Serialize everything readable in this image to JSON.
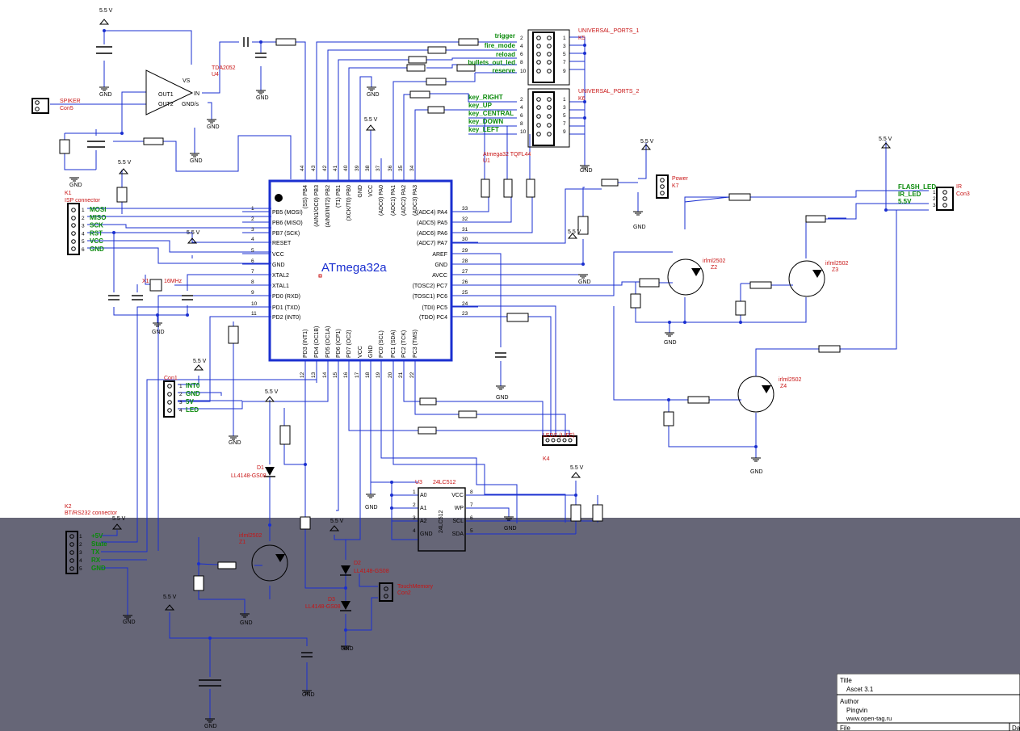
{
  "mcu": {
    "name": "ATmega32a",
    "ref": "U1",
    "package": "Atmega32 TQFL44"
  },
  "power_label": "5.5 V",
  "gnd_label": "GND",
  "mcu_left_pins": [
    {
      "num": "1",
      "name": "PB5 (MOSI)"
    },
    {
      "num": "2",
      "name": "PB6 (MISO)"
    },
    {
      "num": "3",
      "name": "PB7 (SCK)"
    },
    {
      "num": "4",
      "name": "RESET"
    },
    {
      "num": "5",
      "name": "VCC"
    },
    {
      "num": "6",
      "name": "GND"
    },
    {
      "num": "7",
      "name": "XTAL2"
    },
    {
      "num": "8",
      "name": "XTAL1"
    },
    {
      "num": "9",
      "name": "PD0 (RXD)"
    },
    {
      "num": "10",
      "name": "PD1 (TXD)"
    },
    {
      "num": "11",
      "name": "PD2 (INT0)"
    }
  ],
  "mcu_right_pins": [
    {
      "num": "33",
      "name": "(ADC4) PA4"
    },
    {
      "num": "32",
      "name": "(ADC5) PA5"
    },
    {
      "num": "31",
      "name": "(ADC6) PA6"
    },
    {
      "num": "30",
      "name": "(ADC7) PA7"
    },
    {
      "num": "29",
      "name": "AREF"
    },
    {
      "num": "28",
      "name": "GND"
    },
    {
      "num": "27",
      "name": "AVCC"
    },
    {
      "num": "26",
      "name": "(TOSC2) PC7"
    },
    {
      "num": "25",
      "name": "(TOSC1) PC6"
    },
    {
      "num": "24",
      "name": "(TDI) PC5"
    },
    {
      "num": "23",
      "name": "(TDO) PC4"
    }
  ],
  "mcu_top_pins": [
    {
      "num": "44",
      "name": "(SS) PB4"
    },
    {
      "num": "43",
      "name": "(AIN1/OC0) PB3"
    },
    {
      "num": "42",
      "name": "(AIN0/INT2) PB2"
    },
    {
      "num": "41",
      "name": "(T1) PB1"
    },
    {
      "num": "40",
      "name": "(XCK/T0) PB0"
    },
    {
      "num": "39",
      "name": "GND"
    },
    {
      "num": "38",
      "name": "VCC"
    },
    {
      "num": "37",
      "name": "(ADC0) PA0"
    },
    {
      "num": "36",
      "name": "(ADC1) PA1"
    },
    {
      "num": "35",
      "name": "(ADC2) PA2"
    },
    {
      "num": "34",
      "name": "(ADC3) PA3"
    }
  ],
  "mcu_bottom_pins": [
    {
      "num": "12",
      "name": "PD3 (INT1)"
    },
    {
      "num": "13",
      "name": "PD4 (OC1B)"
    },
    {
      "num": "14",
      "name": "PD5 (OC1A)"
    },
    {
      "num": "15",
      "name": "PD6 (ICP1)"
    },
    {
      "num": "16",
      "name": "PD7 (OC2)"
    },
    {
      "num": "17",
      "name": "VCC"
    },
    {
      "num": "18",
      "name": "GND"
    },
    {
      "num": "19",
      "name": "PC0 (SCL)"
    },
    {
      "num": "20",
      "name": "PC1 (SDA)"
    },
    {
      "num": "21",
      "name": "PC2 (TCK)"
    },
    {
      "num": "22",
      "name": "PC3 (TMS)"
    }
  ],
  "universal_ports_1": {
    "ref": "K5",
    "title": "UNIVERSAL_PORTS_1",
    "nets": [
      "trigger",
      "fire_mode",
      "reload",
      "bullets_out_led",
      "reserve"
    ]
  },
  "universal_ports_2": {
    "ref": "K6",
    "title": "UNIVERSAL_PORTS_2",
    "nets": [
      "key_RIGHT",
      "key_UP",
      "key_CENTRAL",
      "key_DOWN",
      "key_LEFT"
    ]
  },
  "isp": {
    "ref": "K1",
    "title": "ISP connector",
    "nets": [
      "MOSI",
      "MISO",
      "SCK",
      "RST",
      "VCC",
      "GND"
    ]
  },
  "con1": {
    "ref": "Con1",
    "nets": [
      "INT0",
      "GND",
      "5V",
      "LED"
    ]
  },
  "bt": {
    "ref": "K2",
    "title": "BT/RS232 connector",
    "nets": [
      "+5V",
      "State",
      "TX",
      "RX",
      "GND"
    ]
  },
  "ir": {
    "ref": "Con3",
    "title": "IR",
    "nets": [
      "FLASH_LED",
      "IR_LED",
      "5.5V"
    ]
  },
  "power_conn": {
    "ref": "K7",
    "title": "Power"
  },
  "spiker": {
    "ref": "Con5",
    "title": "SPIKER"
  },
  "touch": {
    "ref": "Con2",
    "title": "TouchMemory"
  },
  "leds": {
    "ref": "K4",
    "title": "LEDS (LIFE)"
  },
  "amp": {
    "ref": "U4",
    "name": "TDA2052",
    "pins": [
      "IN",
      "OUT1",
      "OUT2",
      "GND/s",
      "VS"
    ]
  },
  "eeprom": {
    "ref": "U3",
    "name": "24LC512",
    "pins": [
      "A0",
      "A1",
      "A2",
      "GND",
      "VCC",
      "WP",
      "SCL",
      "SDA"
    ]
  },
  "mosfets": [
    {
      "ref": "Z1",
      "name": "irlml2502"
    },
    {
      "ref": "Z2",
      "name": "irlml2502"
    },
    {
      "ref": "Z3",
      "name": "irlml2502"
    },
    {
      "ref": "Z4",
      "name": "irlml2502"
    }
  ],
  "diodes": [
    {
      "ref": "D1",
      "name": "LL4148-GS08"
    },
    {
      "ref": "D2",
      "name": "LL4148-GS08"
    },
    {
      "ref": "D3",
      "name": "LL4148-GS08"
    }
  ],
  "crystal": {
    "ref": "X1",
    "value": "16MHz"
  },
  "title_block": {
    "title_label": "Title",
    "title": "Ascet 3.1",
    "author_label": "Author",
    "author": "Pingvin",
    "site": "www.open-tag.ru",
    "file_label": "File",
    "extra": "Da"
  }
}
